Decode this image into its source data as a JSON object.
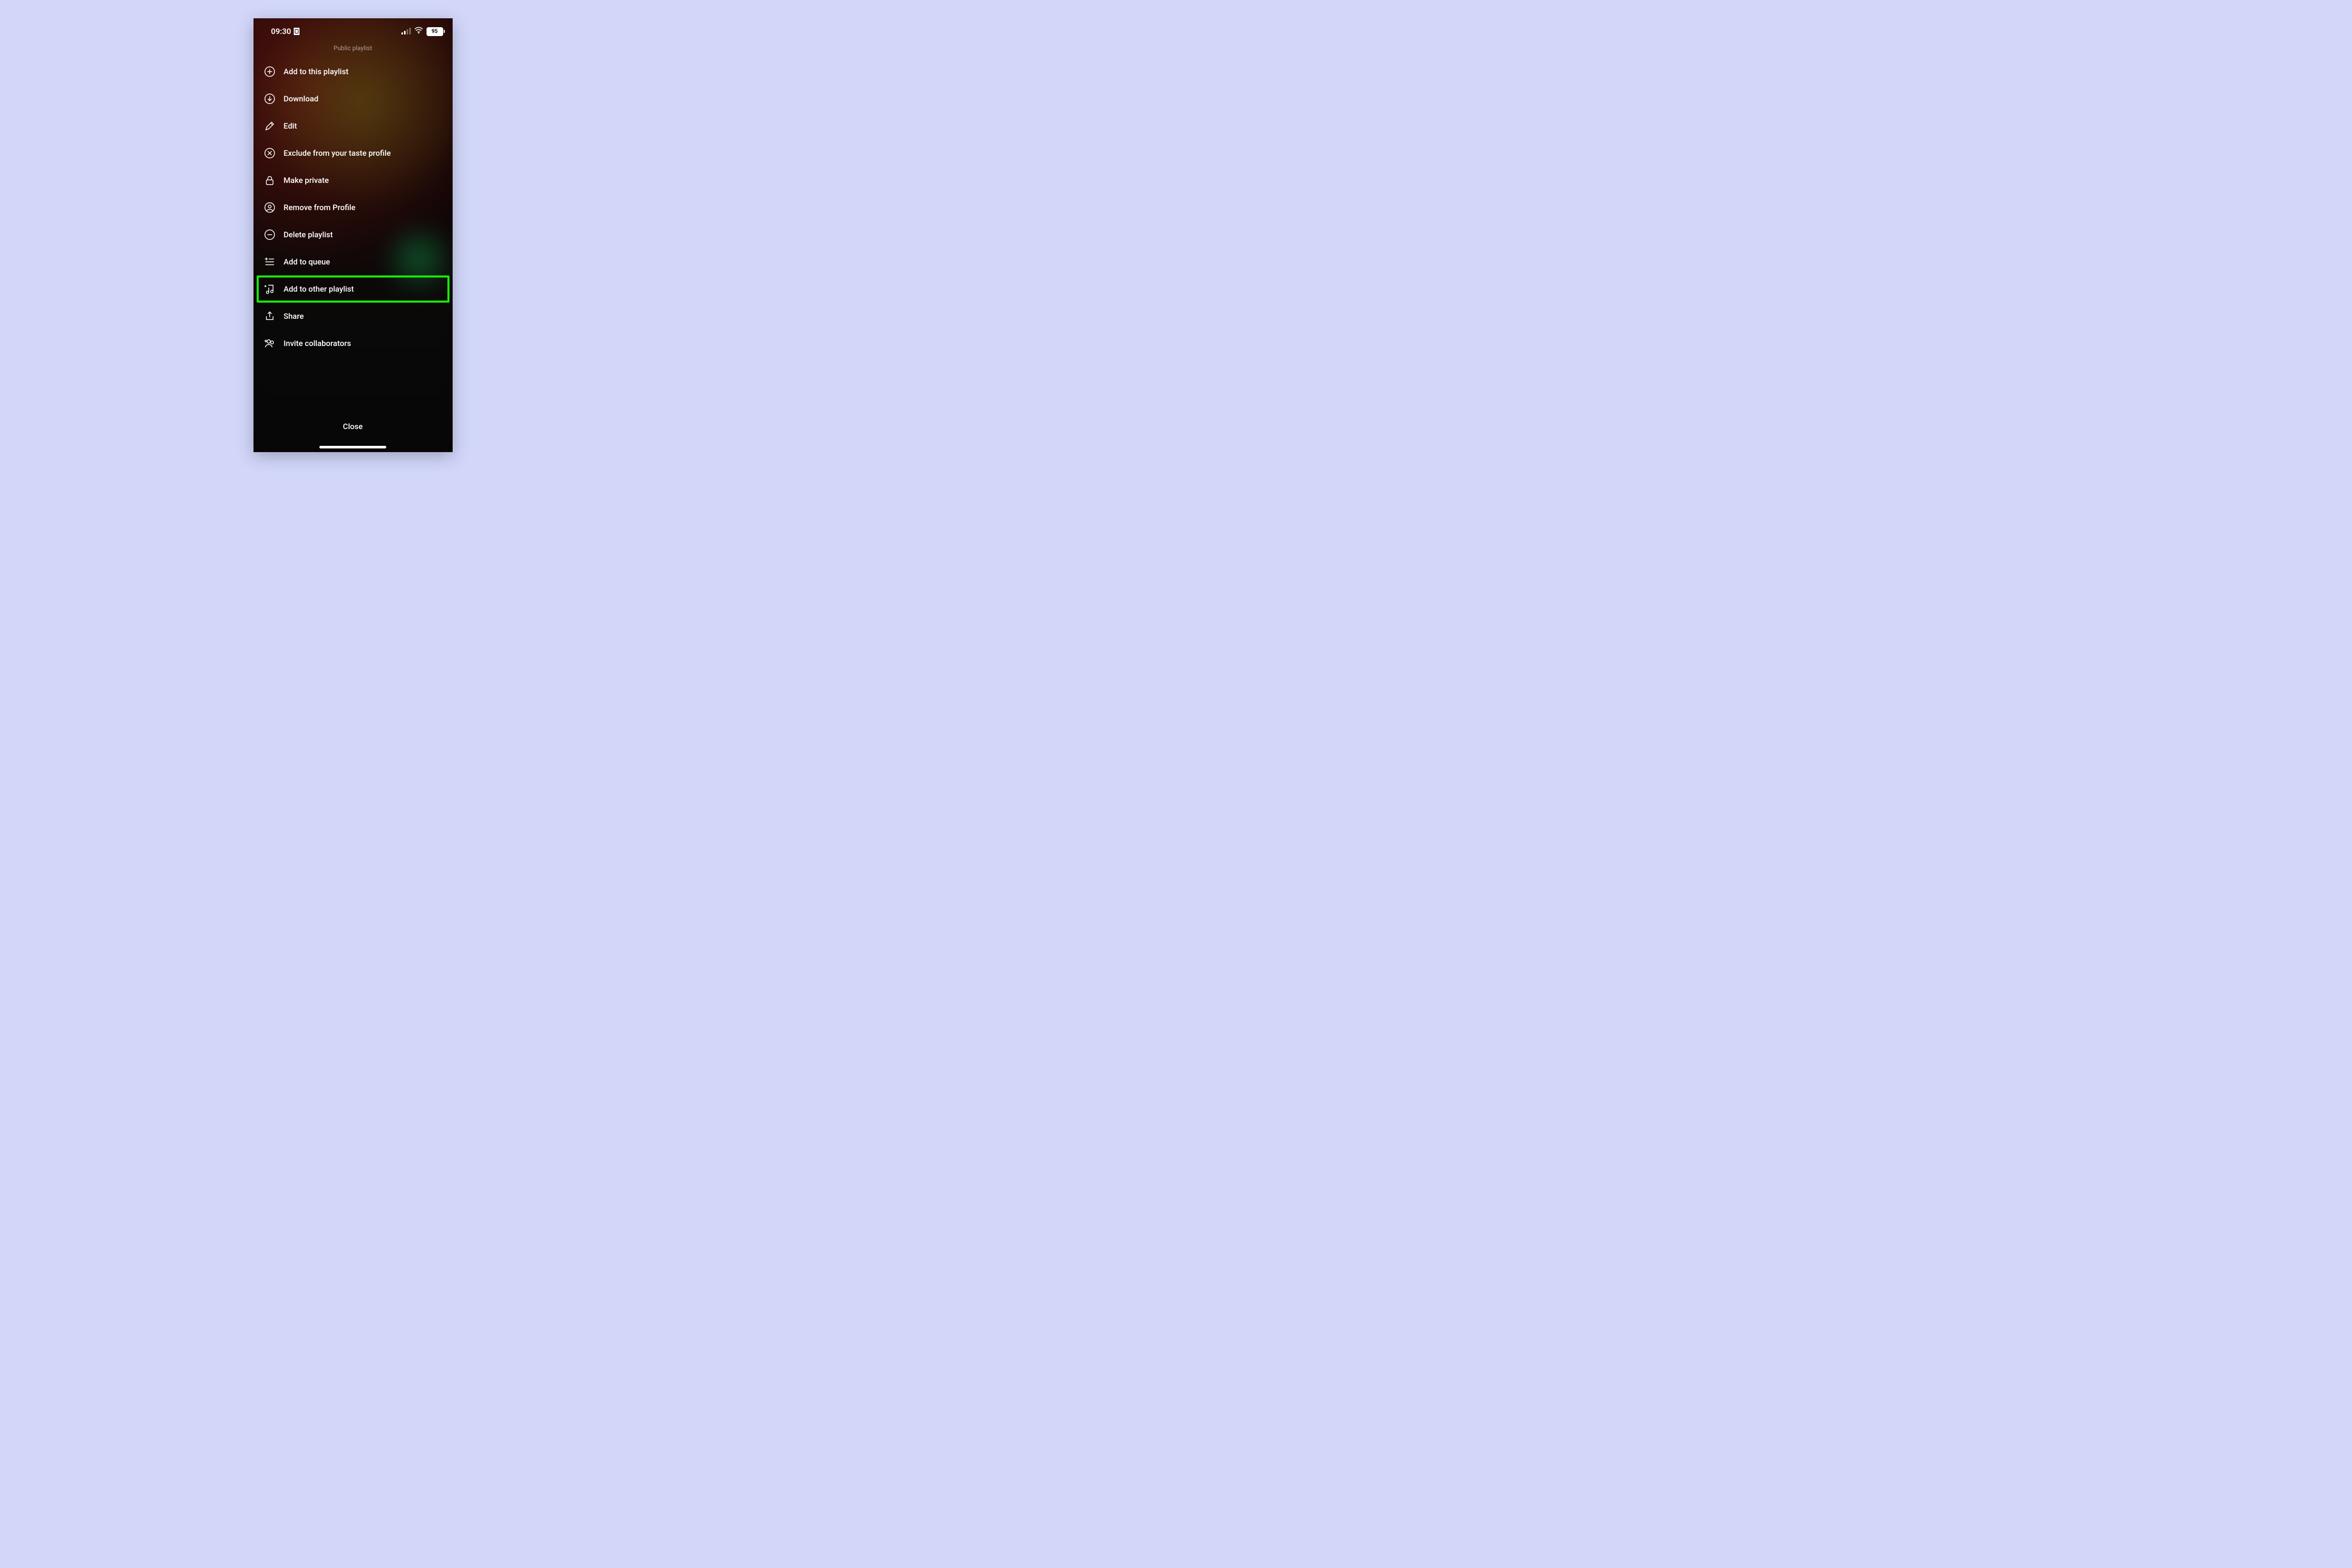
{
  "status": {
    "time": "09:30",
    "battery": "95"
  },
  "header": {
    "subtitle": "Public playlist"
  },
  "menu": {
    "add_to_this": "Add to this playlist",
    "download": "Download",
    "edit": "Edit",
    "exclude": "Exclude from your taste profile",
    "make_private": "Make private",
    "remove_profile": "Remove from Profile",
    "delete": "Delete playlist",
    "add_queue": "Add to queue",
    "add_other": "Add to other playlist",
    "share": "Share",
    "invite": "Invite collaborators"
  },
  "footer": {
    "close": "Close"
  },
  "highlight_color": "#18e80a"
}
